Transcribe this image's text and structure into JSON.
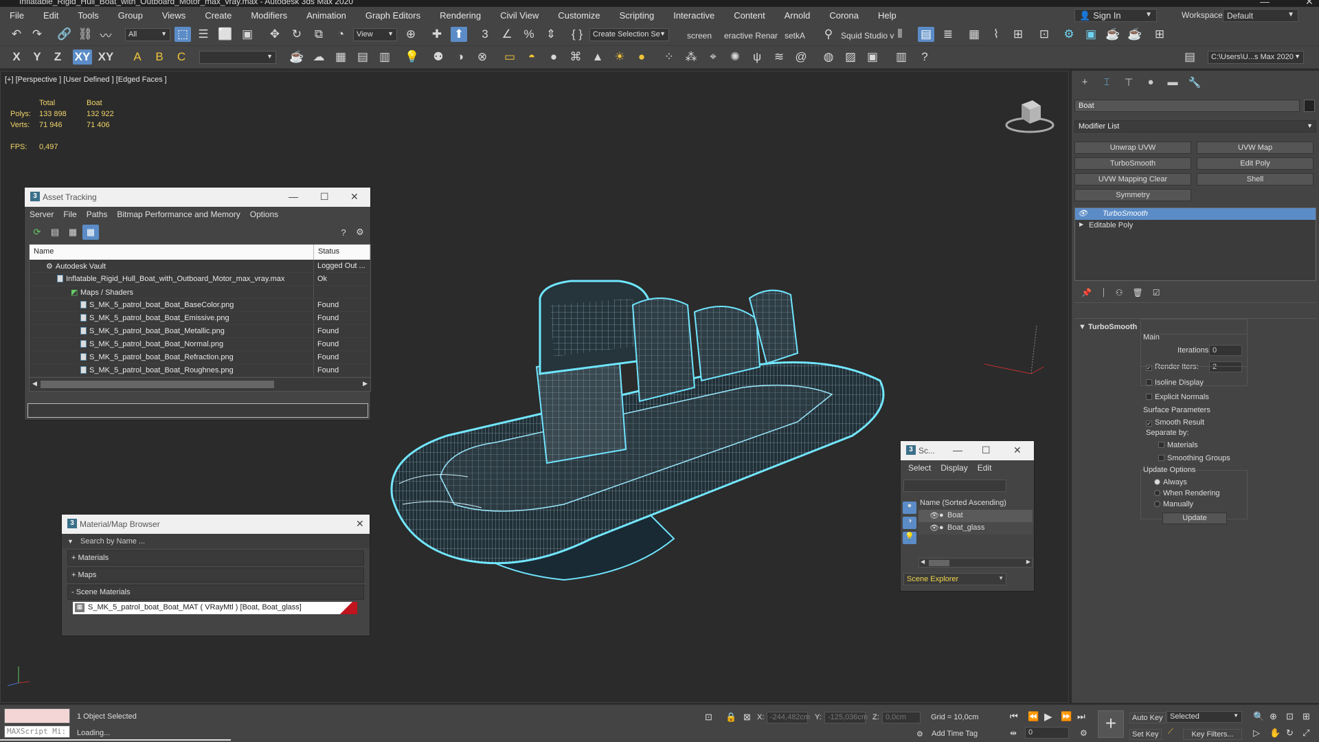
{
  "window": {
    "title": "Inflatable_Rigid_Hull_Boat_with_Outboard_Motor_max_vray.max - Autodesk 3ds Max 2020"
  },
  "menu": [
    "File",
    "Edit",
    "Tools",
    "Group",
    "Views",
    "Create",
    "Modifiers",
    "Animation",
    "Graph Editors",
    "Rendering",
    "Civil View",
    "Customize",
    "Scripting",
    "Interactive",
    "Content",
    "Arnold",
    "Corona",
    "Help"
  ],
  "account": {
    "sign_in": "Sign In",
    "workspaces_label": "Workspaces:",
    "workspace": "Default"
  },
  "toolbar": {
    "filter": "All",
    "ref_coord": "View",
    "selection_set": "Create Selection Se",
    "screen": "screen",
    "interactive": "eractive Renar",
    "setka": "setkA",
    "squid": "Squid Studio v",
    "project_path": "C:\\Users\\U...s Max 2020",
    "axes": [
      "X",
      "Y",
      "Z",
      "XY",
      "XY"
    ]
  },
  "viewport": {
    "label": "[+] [Perspective ] [User Defined ] [Edged Faces ]",
    "stats": {
      "headers": [
        "Total",
        "Boat"
      ],
      "polys_label": "Polys:",
      "polys_total": "133 898",
      "polys_boat": "132 922",
      "verts_label": "Verts:",
      "verts_total": "71 946",
      "verts_boat": "71 406",
      "fps_label": "FPS:",
      "fps": "0,497"
    }
  },
  "asset_tracking": {
    "title": "Asset Tracking",
    "menu": [
      "Server",
      "File",
      "Paths",
      "Bitmap Performance and Memory",
      "Options"
    ],
    "columns": [
      "Name",
      "Status"
    ],
    "rows": [
      {
        "name": "Autodesk Vault",
        "status": "Logged Out ..."
      },
      {
        "name": "Inflatable_Rigid_Hull_Boat_with_Outboard_Motor_max_vray.max",
        "status": "Ok"
      },
      {
        "name": "Maps / Shaders",
        "status": ""
      },
      {
        "name": "S_MK_5_patrol_boat_Boat_BaseColor.png",
        "status": "Found"
      },
      {
        "name": "S_MK_5_patrol_boat_Boat_Emissive.png",
        "status": "Found"
      },
      {
        "name": "S_MK_5_patrol_boat_Boat_Metallic.png",
        "status": "Found"
      },
      {
        "name": "S_MK_5_patrol_boat_Boat_Normal.png",
        "status": "Found"
      },
      {
        "name": "S_MK_5_patrol_boat_Boat_Refraction.png",
        "status": "Found"
      },
      {
        "name": "S_MK_5_patrol_boat_Boat_Roughnes.png",
        "status": "Found"
      }
    ]
  },
  "material_browser": {
    "title": "Material/Map Browser",
    "search_placeholder": "Search by Name ...",
    "groups": [
      "+ Materials",
      "+ Maps",
      "- Scene Materials"
    ],
    "material": "S_MK_5_patrol_boat_Boat_MAT ( VRayMtl ) [Boat, Boat_glass]"
  },
  "scene_explorer": {
    "title": "Sc...",
    "menu": [
      "Select",
      "Display",
      "Edit"
    ],
    "column": "Name (Sorted Ascending)",
    "items": [
      "Boat",
      "Boat_glass"
    ],
    "footer": "Scene Explorer"
  },
  "command_panel": {
    "object_name": "Boat",
    "modifier_list": "Modifier List",
    "buttons": [
      "Unwrap UVW",
      "UVW Map",
      "TurboSmooth",
      "Edit Poly",
      "UVW Mapping Clear",
      "Shell",
      "Symmetry"
    ],
    "stack": [
      "TurboSmooth",
      "Editable Poly"
    ],
    "rollout": {
      "title": "TurboSmooth",
      "main": "Main",
      "iterations_label": "Iterations:",
      "iterations": "0",
      "render_iters_label": "Render Iters:",
      "render_iters": "2",
      "isoline": "Isoline Display",
      "explicit": "Explicit Normals",
      "surface": "Surface Parameters",
      "smooth_result": "Smooth Result",
      "separate": "Separate by:",
      "materials": "Materials",
      "smoothing_groups": "Smoothing Groups",
      "update_options": "Update Options",
      "always": "Always",
      "when_rendering": "When Rendering",
      "manually": "Manually",
      "update": "Update"
    }
  },
  "statusbar": {
    "maxscript": "MAXScript Mi:",
    "selected": "1 Object Selected",
    "loading": "Loading...",
    "x_label": "X:",
    "x": "-244,482cm",
    "y_label": "Y:",
    "y": "-125,036cm",
    "z_label": "Z:",
    "z": "0,0cm",
    "grid": "Grid = 10,0cm",
    "add_time_tag": "Add Time Tag",
    "auto_key": "Auto Key",
    "selected_dd": "Selected",
    "set_key": "Set Key",
    "key_filters": "Key Filters...",
    "frame": "0"
  },
  "colors": {
    "accent": "#5b8cc7",
    "wire": "#6fe6ff",
    "stats": "#f2d46a"
  }
}
